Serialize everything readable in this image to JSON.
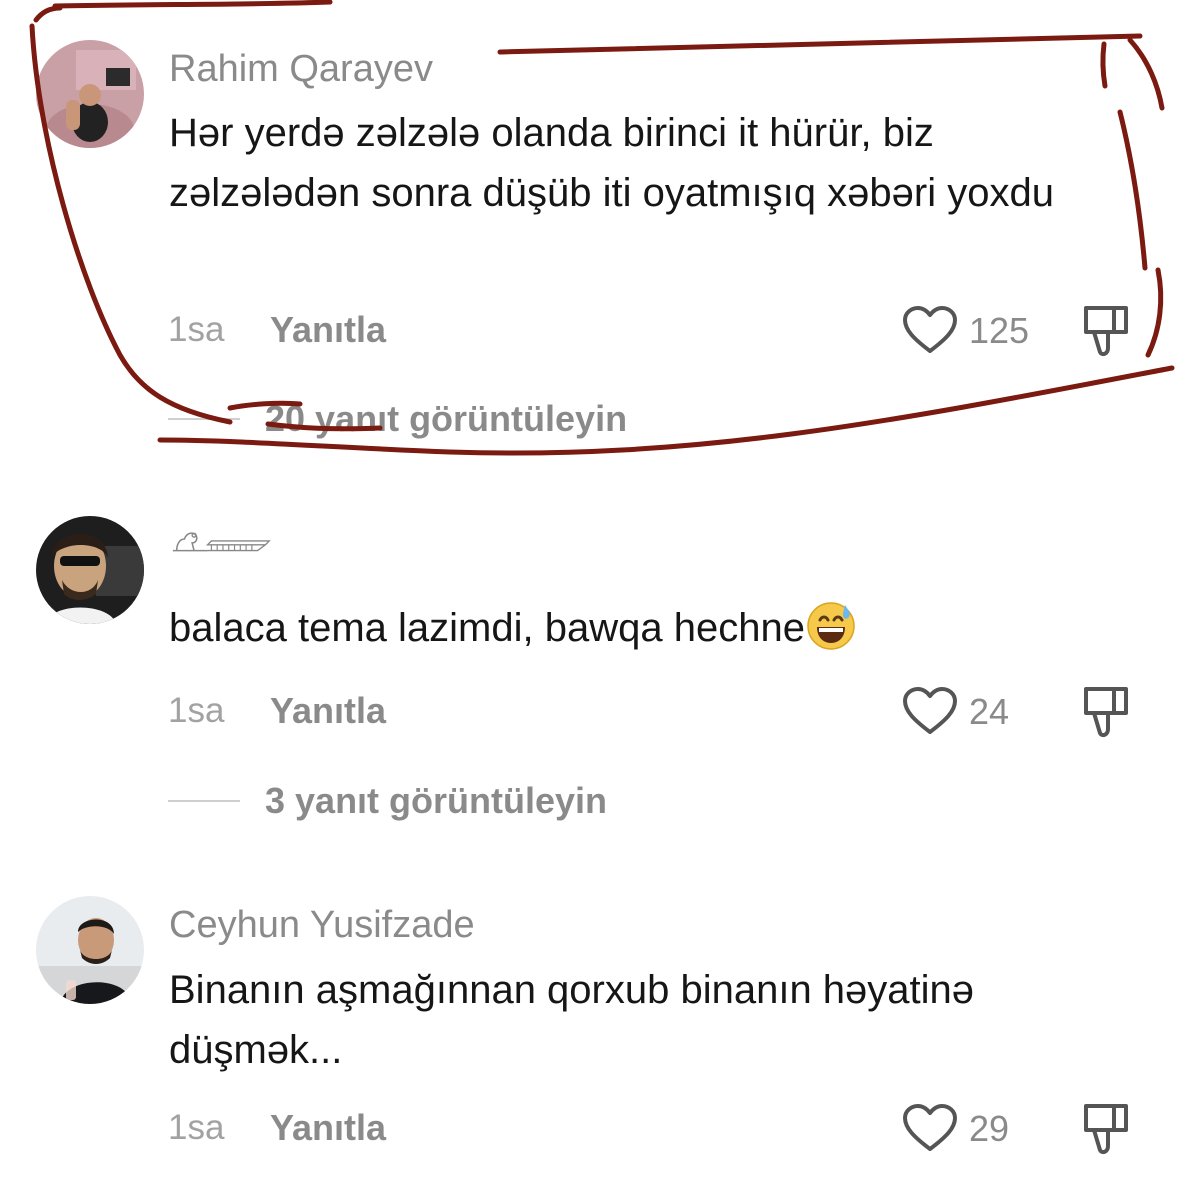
{
  "comments": [
    {
      "username": "Rahim Qarayev",
      "text": "Hər yerdə zəlzələ olanda birinci it hürür, biz zəlzələdən sonra düşüb iti oyatmışıq xəbəri yoxdu",
      "time": "1sa",
      "reply_label": "Yanıtla",
      "likes": "125",
      "view_replies": "20 yanıt görüntüleyin"
    },
    {
      "username": "",
      "text": "balaca tema lazimdi, bawqa hechne",
      "time": "1sa",
      "reply_label": "Yanıtla",
      "likes": "24",
      "view_replies": "3 yanıt görüntüleyin"
    },
    {
      "username": "Ceyhun Yusifzade",
      "text": "Binanın aşmağınnan qorxub binanın həyatinə düşmək...",
      "time": "1sa",
      "reply_label": "Yanıtla",
      "likes": "29"
    }
  ],
  "icons": {
    "like": "heart-outline-icon",
    "dislike": "thumbs-down-outline-icon",
    "emoji": "grinning-face-with-sweat-emoji",
    "username_glyph": "sphinx-glyph-icon"
  },
  "colors": {
    "annotation_stroke": "#7a1a10",
    "username": "#8a8a8a",
    "text": "#161616"
  }
}
